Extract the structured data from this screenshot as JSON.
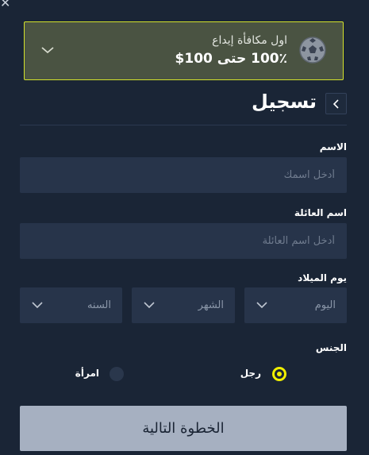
{
  "bonus": {
    "subtitle": "اول مكافأة إيداع",
    "headline": "100٪ حتى 100$"
  },
  "header": {
    "title": "تسجيل"
  },
  "form": {
    "first_name": {
      "label": "الاسم",
      "placeholder": "أدخل اسمك"
    },
    "last_name": {
      "label": "اسم العائلة",
      "placeholder": "أدخل اسم العائلة"
    },
    "birthdate": {
      "label": "يوم الميلاد",
      "day": "اليوم",
      "month": "الشهر",
      "year": "السنه"
    },
    "gender": {
      "label": "الجنس",
      "options": [
        {
          "label": "رجل",
          "selected": true
        },
        {
          "label": "امرأة",
          "selected": false
        }
      ]
    },
    "next_label": "الخطوة التالية"
  },
  "colors": {
    "background": "#1a2536",
    "field": "#27344a",
    "accent": "#f0ef00",
    "bonus_bg": "#4a5342",
    "button": "#a6b0c1"
  }
}
